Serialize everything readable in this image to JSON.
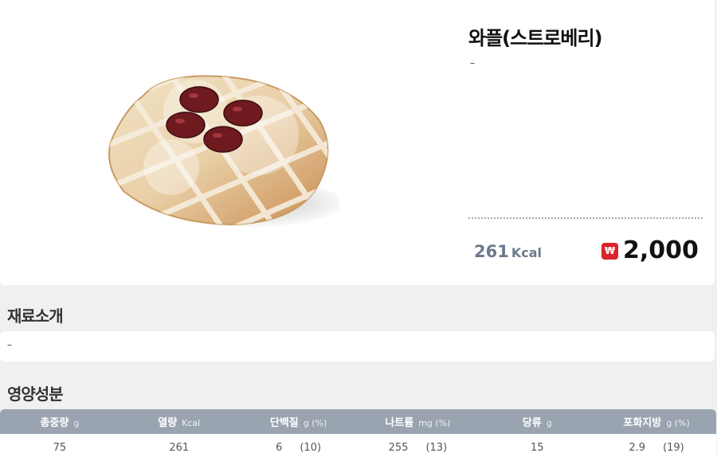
{
  "product": {
    "name": "와플(스트로베리)",
    "description": "–",
    "calories": "261",
    "calories_unit": "Kcal",
    "currency_symbol": "₩",
    "price": "2,000",
    "image": "waffle-product-photo"
  },
  "ingredients": {
    "title": "재료소개",
    "text": "–"
  },
  "nutrition": {
    "title": "영양성분",
    "columns": [
      {
        "label": "총중량",
        "unit": "g"
      },
      {
        "label": "열량",
        "unit": "Kcal"
      },
      {
        "label": "단백질",
        "unit": "g (%)"
      },
      {
        "label": "나트륨",
        "unit": "mg (%)"
      },
      {
        "label": "당류",
        "unit": "g"
      },
      {
        "label": "포화지방",
        "unit": "g (%)"
      }
    ],
    "row": [
      {
        "value": "75",
        "pct": ""
      },
      {
        "value": "261",
        "pct": ""
      },
      {
        "value": "6",
        "pct": "(10)"
      },
      {
        "value": "255",
        "pct": "(13)"
      },
      {
        "value": "15",
        "pct": ""
      },
      {
        "value": "2.9",
        "pct": "(19)"
      }
    ]
  },
  "colors": {
    "accent_red": "#d9252b",
    "header_gray": "#9aa4b0",
    "kcal_blue_gray": "#6b7a8c"
  }
}
